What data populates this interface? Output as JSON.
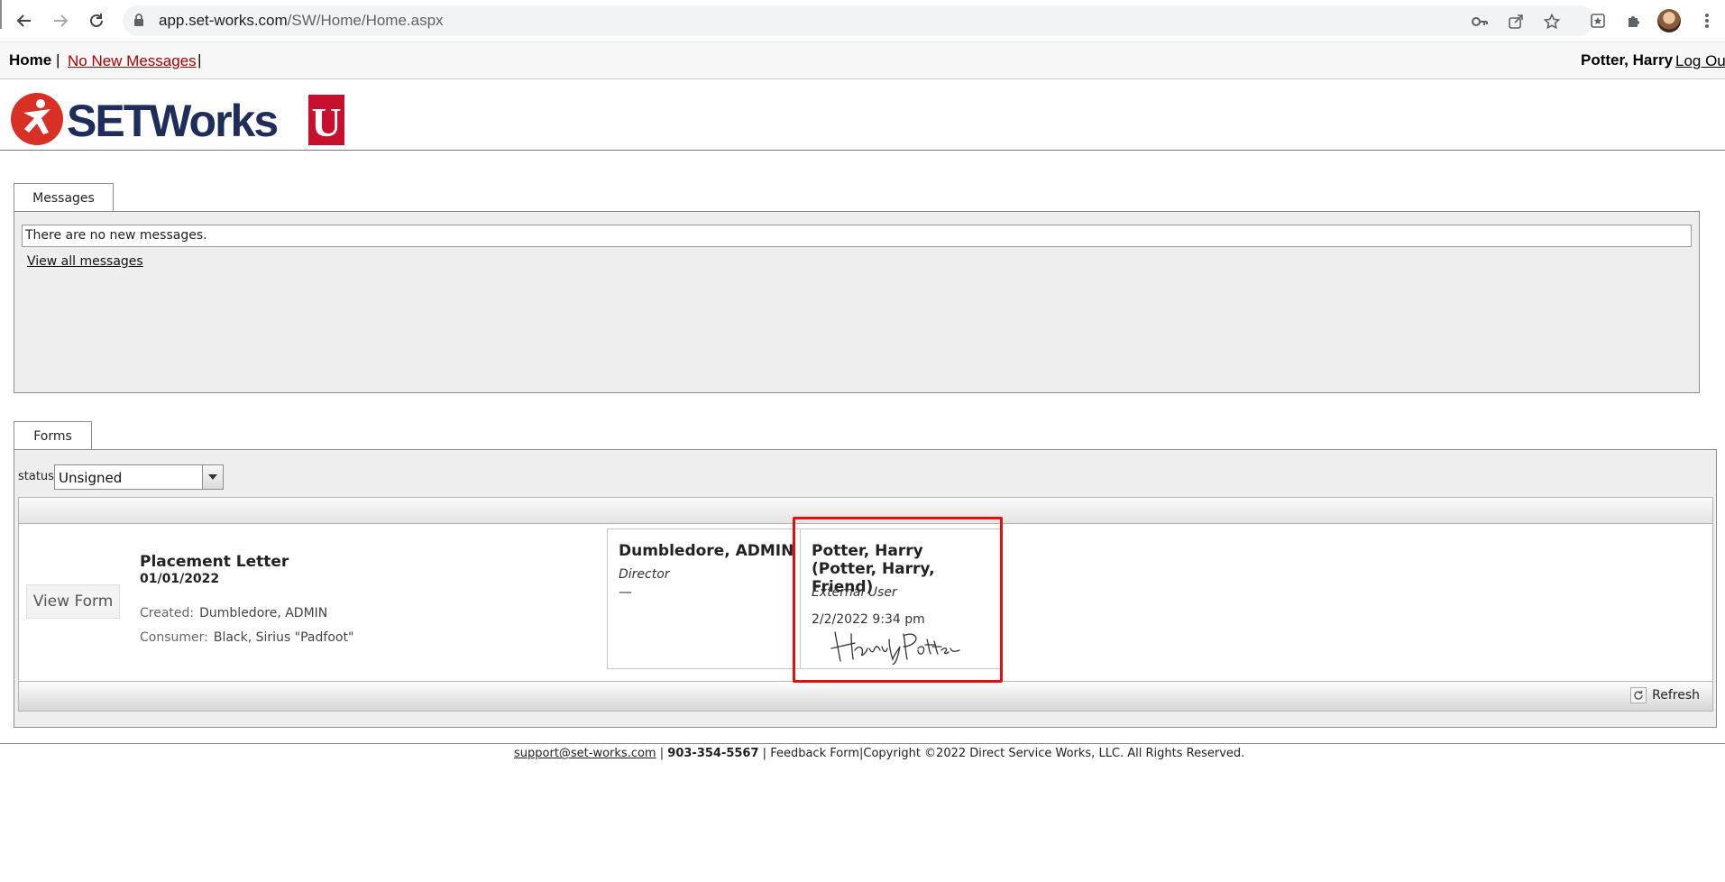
{
  "browser": {
    "url_host": "app.set-works.com",
    "url_path": "/SW/Home/Home.aspx"
  },
  "topnav": {
    "home": "Home",
    "separator": "|",
    "messages_link": "No New Messages",
    "user_name": "Potter, Harry",
    "logout": "Log Out"
  },
  "logo": {
    "text": "SETWorks",
    "badge": "U"
  },
  "messages": {
    "tab_label": "Messages",
    "box_text": "There are no new messages.",
    "view_all": "View all messages"
  },
  "forms": {
    "tab_label": "Forms",
    "status_label": "status:",
    "status_value": "Unsigned",
    "row": {
      "view_button": "View Form",
      "title": "Placement Letter",
      "date": "01/01/2022",
      "created_label": "Created:",
      "created_value": "Dumbledore, ADMIN",
      "consumer_label": "Consumer:",
      "consumer_value": "Black, Sirius \"Padfoot\""
    },
    "signatures": [
      {
        "name": "Dumbledore, ADMIN",
        "role": "Director",
        "status": "—"
      },
      {
        "name": "Potter, Harry (Potter, Harry, Friend)",
        "role": "External User",
        "signed_at": "2/2/2022 9:34 pm"
      }
    ],
    "refresh_label": "Refresh"
  },
  "footer": {
    "email": "support@set-works.com",
    "sep": "|",
    "phone": "903-354-5567",
    "feedback": "Feedback Form",
    "copyright": "Copyright ©2022 Direct Service Works, LLC. All Rights Reserved."
  },
  "colors": {
    "highlight": "#e01010",
    "logo_red": "#d93025",
    "logo_navy": "#1f2d5a",
    "link_red": "#b00000"
  }
}
